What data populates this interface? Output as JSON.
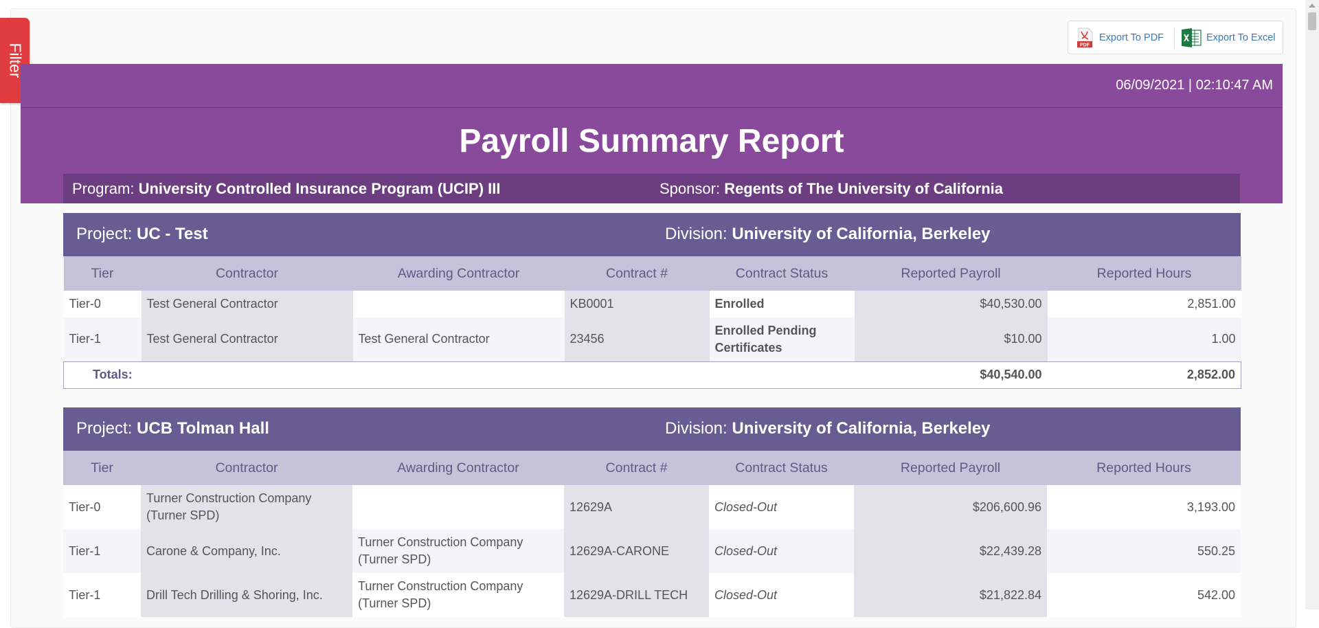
{
  "filter_label": "Filter",
  "export": {
    "pdf_label": "Export To PDF",
    "excel_label": "Export To Excel",
    "pdf_icon_text": "PDF"
  },
  "banner": {
    "datetime": "06/09/2021 | 02:10:47 AM",
    "title": "Payroll Summary Report",
    "program_label": "Program:",
    "program_value": "University Controlled Insurance Program (UCIP) III",
    "sponsor_label": "Sponsor:",
    "sponsor_value": "Regents of The University of California"
  },
  "columns": [
    "Tier",
    "Contractor",
    "Awarding Contractor",
    "Contract #",
    "Contract Status",
    "Reported Payroll",
    "Reported Hours"
  ],
  "projects": [
    {
      "project_label": "Project:",
      "project_name": "UC - Test",
      "division_label": "Division:",
      "division_name": "University of California, Berkeley",
      "rows": [
        {
          "tier": "Tier-0",
          "contractor": "Test General Contractor",
          "awarding": "",
          "contract": "KB0001",
          "status": "Enrolled",
          "payroll": "$40,530.00",
          "hours": "2,851.00"
        },
        {
          "tier": "Tier-1",
          "contractor": "Test General Contractor",
          "awarding": "Test General Contractor",
          "contract": "23456",
          "status": "Enrolled Pending Certificates",
          "payroll": "$10.00",
          "hours": "1.00"
        }
      ],
      "totals": {
        "label": "Totals:",
        "payroll": "$40,540.00",
        "hours": "2,852.00"
      }
    },
    {
      "project_label": "Project:",
      "project_name": "UCB Tolman Hall",
      "division_label": "Division:",
      "division_name": "University of California, Berkeley",
      "rows": [
        {
          "tier": "Tier-0",
          "contractor": "Turner Construction Company (Turner SPD)",
          "awarding": "",
          "contract": "12629A",
          "status": "Closed-Out",
          "payroll": "$206,600.96",
          "hours": "3,193.00"
        },
        {
          "tier": "Tier-1",
          "contractor": "Carone & Company, Inc.",
          "awarding": "Turner Construction Company (Turner SPD)",
          "contract": "12629A-CARONE",
          "status": "Closed-Out",
          "payroll": "$22,439.28",
          "hours": "550.25"
        },
        {
          "tier": "Tier-1",
          "contractor": "Drill Tech Drilling & Shoring, Inc.",
          "awarding": "Turner Construction Company (Turner SPD)",
          "contract": "12629A-DRILL TECH",
          "status": "Closed-Out",
          "payroll": "$21,822.84",
          "hours": "542.00"
        }
      ]
    }
  ],
  "colors": {
    "banner": "#8a4a9c",
    "program_bar": "#6c3d80",
    "project_header": "#675d93",
    "column_header": "#c6c2d9",
    "filter_tab": "#e03b3f"
  }
}
